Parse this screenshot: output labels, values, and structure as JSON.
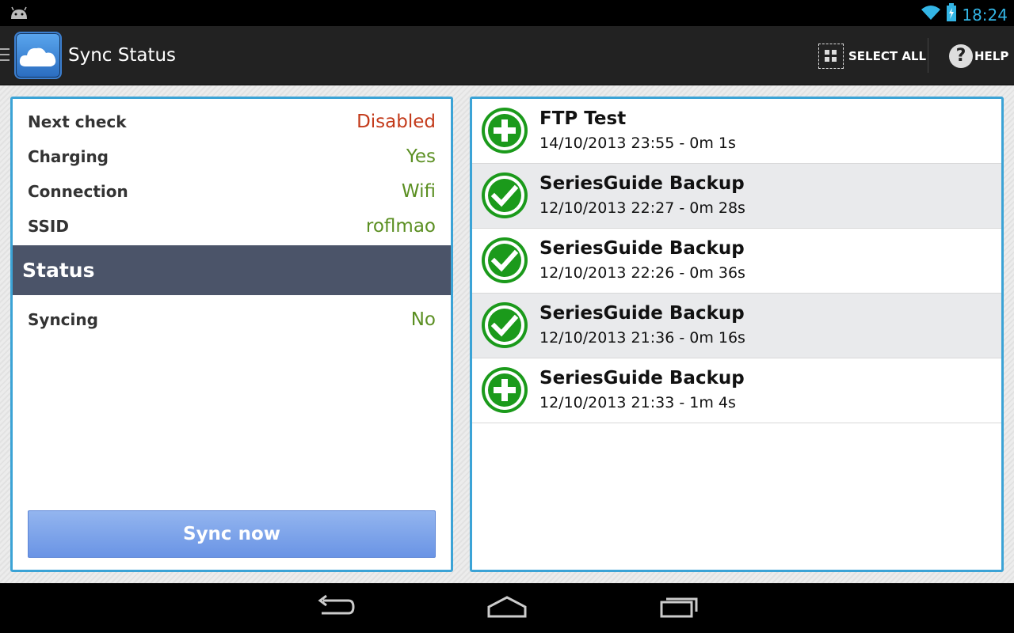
{
  "status_bar": {
    "time": "18:24",
    "icons": [
      "android-icon",
      "wifi-icon",
      "battery-charging-icon"
    ]
  },
  "action_bar": {
    "title": "Sync Status",
    "select_all_label": "SELECT ALL",
    "help_label": "HELP",
    "help_glyph": "?"
  },
  "info": {
    "rows": [
      {
        "label": "Next check",
        "value": "Disabled",
        "color": "#c33a1a"
      },
      {
        "label": "Charging",
        "value": "Yes",
        "color": "#5b8f22"
      },
      {
        "label": "Connection",
        "value": "Wifi",
        "color": "#5b8f22"
      },
      {
        "label": "SSID",
        "value": "roflmao",
        "color": "#5b8f22"
      }
    ],
    "status_header": "Status",
    "status_rows": [
      {
        "label": "Syncing",
        "value": "No",
        "color": "#5b8f22"
      }
    ],
    "sync_button": "Sync now"
  },
  "history": [
    {
      "name": "FTP Test",
      "meta": "14/10/2013 23:55 - 0m 1s",
      "icon": "plus-icon"
    },
    {
      "name": "SeriesGuide Backup",
      "meta": "12/10/2013 22:27 - 0m 28s",
      "icon": "check-icon"
    },
    {
      "name": "SeriesGuide Backup",
      "meta": "12/10/2013 22:26 - 0m 36s",
      "icon": "check-icon"
    },
    {
      "name": "SeriesGuide Backup",
      "meta": "12/10/2013 21:36 - 0m 16s",
      "icon": "check-icon"
    },
    {
      "name": "SeriesGuide Backup",
      "meta": "12/10/2013 21:33 - 1m 4s",
      "icon": "plus-icon"
    }
  ],
  "colors": {
    "accent": "#33b5e5",
    "panel_border": "#3ba3d6",
    "status_header_bg": "#4b5469",
    "icon_green": "#1b9a1b"
  },
  "nav": [
    "back-icon",
    "home-icon",
    "recents-icon"
  ]
}
